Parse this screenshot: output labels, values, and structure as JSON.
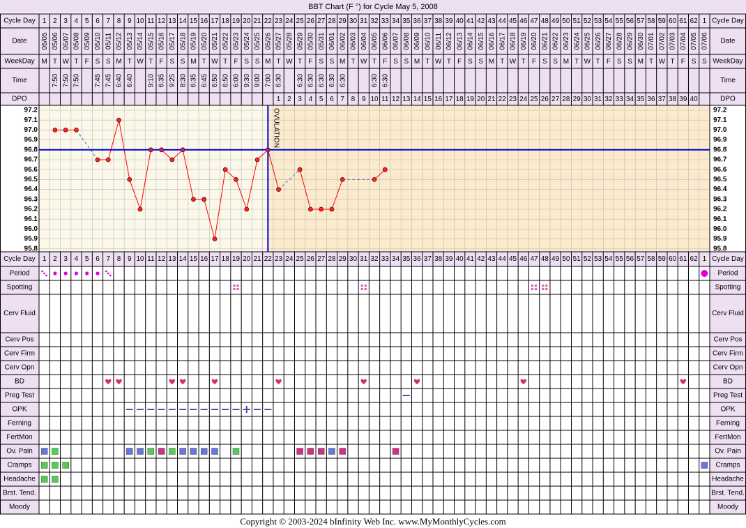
{
  "title": "BBT Chart (F °) for Cycle May 5, 2008",
  "copyright": "Copyright © 2003-2024 bInfinity Web Inc.     www.MyMonthlyCycles.com",
  "labels": {
    "cycle_day": "Cycle Day",
    "date": "Date",
    "weekday": "WeekDay",
    "time": "Time",
    "dpo": "DPO",
    "period": "Period",
    "spotting": "Spotting",
    "cerv_fluid": "Cerv Fluid",
    "cerv_pos": "Cerv Pos",
    "cerv_firm": "Cerv Firm",
    "cerv_opn": "Cerv Opn",
    "bd": "BD",
    "preg_test": "Preg Test",
    "opk": "OPK",
    "ferning": "Ferning",
    "fertmon": "FertMon",
    "ov_pain": "Ov. Pain",
    "cramps": "Cramps",
    "headache": "Headache",
    "brst_tend": "Brst. Tend.",
    "moody": "Moody"
  },
  "ovulation_label": "OVULATION",
  "colors": {
    "header_bg": "#eedff3",
    "chart_pre_bg": "#fbf8ea",
    "chart_post_bg": "#fbebcc",
    "grid": "#bbbbbb",
    "line": "#ff0000",
    "point": "#ff2222",
    "coverline": "#0000cc",
    "ovulation": "#0000cc",
    "period": "#dd00dd",
    "spotting": "#e060c0",
    "heart": "#d0306a",
    "blue_square": "#6677dd",
    "green_square": "#55cc55",
    "magenta_square": "#cc3388",
    "opk_dash": "#5544bb"
  },
  "chart_data": {
    "type": "line",
    "cycle_days": [
      1,
      2,
      3,
      4,
      5,
      6,
      7,
      8,
      9,
      10,
      11,
      12,
      13,
      14,
      15,
      16,
      17,
      18,
      19,
      20,
      21,
      22,
      23,
      24,
      25,
      26,
      27,
      28,
      29,
      30,
      31,
      32,
      33,
      34,
      35,
      36,
      37,
      38,
      39,
      40,
      41,
      42,
      43,
      44,
      45,
      46,
      47,
      48,
      49,
      50,
      51,
      52,
      53,
      54,
      55,
      56,
      57,
      58,
      59,
      60,
      61,
      62,
      1
    ],
    "dates": [
      "05/05",
      "05/06",
      "05/07",
      "05/08",
      "05/09",
      "05/10",
      "05/11",
      "05/12",
      "05/13",
      "05/14",
      "05/15",
      "05/16",
      "05/17",
      "05/18",
      "05/19",
      "05/20",
      "05/21",
      "05/22",
      "05/23",
      "05/24",
      "05/25",
      "05/26",
      "05/27",
      "05/28",
      "05/29",
      "05/30",
      "05/31",
      "06/01",
      "06/02",
      "06/03",
      "06/04",
      "06/05",
      "06/06",
      "06/07",
      "06/08",
      "06/09",
      "06/10",
      "06/11",
      "06/12",
      "06/13",
      "06/14",
      "06/15",
      "06/16",
      "06/17",
      "06/18",
      "06/19",
      "06/20",
      "06/21",
      "06/22",
      "06/23",
      "06/24",
      "06/25",
      "06/26",
      "06/27",
      "06/28",
      "06/29",
      "06/30",
      "07/01",
      "07/02",
      "07/03",
      "07/04",
      "07/05",
      "07/06"
    ],
    "weekdays": [
      "M",
      "T",
      "W",
      "T",
      "F",
      "S",
      "S",
      "M",
      "T",
      "W",
      "T",
      "F",
      "S",
      "S",
      "M",
      "T",
      "W",
      "T",
      "F",
      "S",
      "S",
      "M",
      "T",
      "W",
      "T",
      "F",
      "S",
      "S",
      "M",
      "T",
      "W",
      "T",
      "F",
      "S",
      "S",
      "M",
      "T",
      "W",
      "T",
      "F",
      "S",
      "S",
      "M",
      "T",
      "W",
      "T",
      "F",
      "S",
      "S",
      "M",
      "T",
      "W",
      "T",
      "F",
      "S",
      "S",
      "M",
      "T",
      "W",
      "T",
      "F",
      "S",
      "S"
    ],
    "times": [
      "",
      "7:50",
      "7:50",
      "7:50",
      "",
      "7:45",
      "7:45",
      "6:40",
      "6:40",
      "",
      "9:10",
      "6:35",
      "9:25",
      "8:30",
      "6:35",
      "6:45",
      "6:50",
      "6:50",
      "6:00",
      "9:30",
      "9:00",
      "7:00",
      "6:30",
      "",
      "6:30",
      "6:30",
      "6:30",
      "6:30",
      "6:30",
      "",
      "",
      "6:30",
      "6:30",
      "",
      "",
      "",
      "",
      "",
      "",
      "",
      "",
      "",
      "",
      "",
      "",
      "",
      "",
      "",
      "",
      "",
      "",
      "",
      "",
      "",
      "",
      "",
      "",
      "",
      "",
      "",
      "",
      "",
      ""
    ],
    "dpo": [
      "",
      "",
      "",
      "",
      "",
      "",
      "",
      "",
      "",
      "",
      "",
      "",
      "",
      "",
      "",
      "",
      "",
      "",
      "",
      "",
      "",
      "",
      "1",
      "2",
      "3",
      "4",
      "5",
      "6",
      "7",
      "8",
      "9",
      "10",
      "11",
      "12",
      "13",
      "14",
      "15",
      "16",
      "17",
      "18",
      "19",
      "20",
      "21",
      "22",
      "23",
      "24",
      "25",
      "26",
      "27",
      "28",
      "29",
      "30",
      "31",
      "32",
      "33",
      "34",
      "35",
      "36",
      "37",
      "38",
      "39",
      "40",
      ""
    ],
    "y_ticks": [
      "97.2",
      "97.1",
      "97.0",
      "96.9",
      "96.8",
      "96.7",
      "96.6",
      "96.5",
      "96.4",
      "96.3",
      "96.2",
      "96.1",
      "96.0",
      "95.9",
      "95.8"
    ],
    "ylim": [
      95.8,
      97.2
    ],
    "temps": [
      null,
      97.0,
      97.0,
      97.0,
      null,
      96.7,
      96.7,
      97.1,
      96.5,
      96.2,
      96.8,
      96.8,
      96.7,
      96.8,
      96.3,
      96.3,
      95.9,
      96.6,
      96.5,
      96.2,
      96.7,
      96.8,
      96.4,
      null,
      96.6,
      96.2,
      96.2,
      96.2,
      96.5,
      null,
      null,
      96.5,
      96.6
    ],
    "coverline": 96.8,
    "ovulation_day": 22,
    "period": [
      "light",
      "medium",
      "medium",
      "medium",
      "medium",
      "medium",
      "light",
      "",
      "",
      "",
      "",
      "",
      "",
      "",
      "",
      "",
      "",
      "",
      "",
      "",
      "",
      "",
      "",
      "",
      "",
      "",
      "",
      "",
      "",
      "",
      "",
      "",
      "",
      "",
      "",
      "",
      "",
      "",
      "",
      "",
      "",
      "",
      "",
      "",
      "",
      "",
      "",
      "",
      "",
      "",
      "",
      "",
      "",
      "",
      "",
      "",
      "",
      "",
      "",
      "",
      "",
      "",
      "heavy"
    ],
    "spotting_days": [
      19,
      31,
      47,
      48
    ],
    "bd_days": [
      7,
      8,
      13,
      14,
      17,
      23,
      31,
      36,
      46,
      61
    ],
    "preg_test_days": [
      35
    ],
    "opk": {
      "9": "-",
      "10": "-",
      "11": "-",
      "12": "-",
      "13": "-",
      "14": "-",
      "15": "-",
      "16": "-",
      "17": "-",
      "18": "-",
      "19": "-",
      "20": "+",
      "21": "-",
      "22": "-"
    },
    "ov_pain": {
      "1": "blue",
      "2": "green",
      "9": "blue",
      "10": "blue",
      "11": "green",
      "12": "magenta",
      "13": "green",
      "14": "blue",
      "15": "blue",
      "16": "blue",
      "17": "blue",
      "19": "green",
      "25": "magenta",
      "26": "magenta",
      "27": "magenta",
      "28": "blue",
      "29": "magenta",
      "34": "magenta"
    },
    "cramps": {
      "1": "green",
      "2": "green",
      "3": "green",
      "63": "blue"
    },
    "headache": {
      "1": "green",
      "2": "green"
    }
  }
}
